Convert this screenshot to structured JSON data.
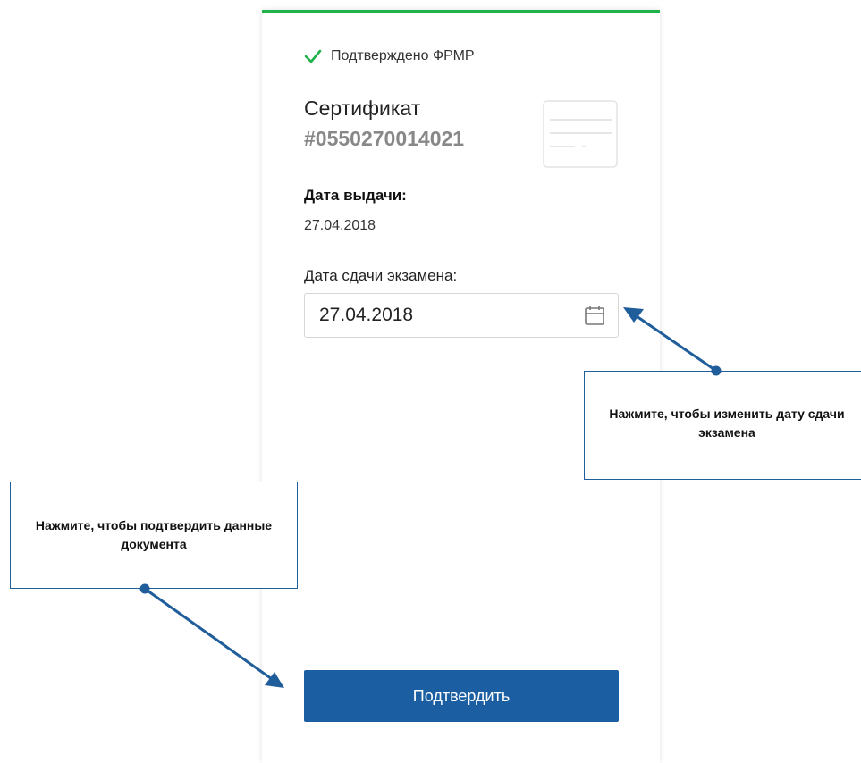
{
  "card": {
    "accent_color": "#1fb14a",
    "verified_text": "Подтверждено ФРМР",
    "cert_title": "Сертификат",
    "cert_number": "#0550270014021",
    "issue_label": "Дата выдачи:",
    "issue_value": "27.04.2018",
    "exam_label": "Дата сдачи экзамена:",
    "exam_date_value": "27.04.2018",
    "confirm_label": "Подтвердить",
    "button_color": "#1b5ea1"
  },
  "annotations": {
    "date_hint": "Нажмите, чтобы изменить дату сдачи экзамена",
    "confirm_hint": "Нажмите, чтобы подтвердить данные документа",
    "color": "#1f5e9a"
  },
  "icons": [
    "check-icon",
    "document-icon",
    "calendar-icon"
  ]
}
